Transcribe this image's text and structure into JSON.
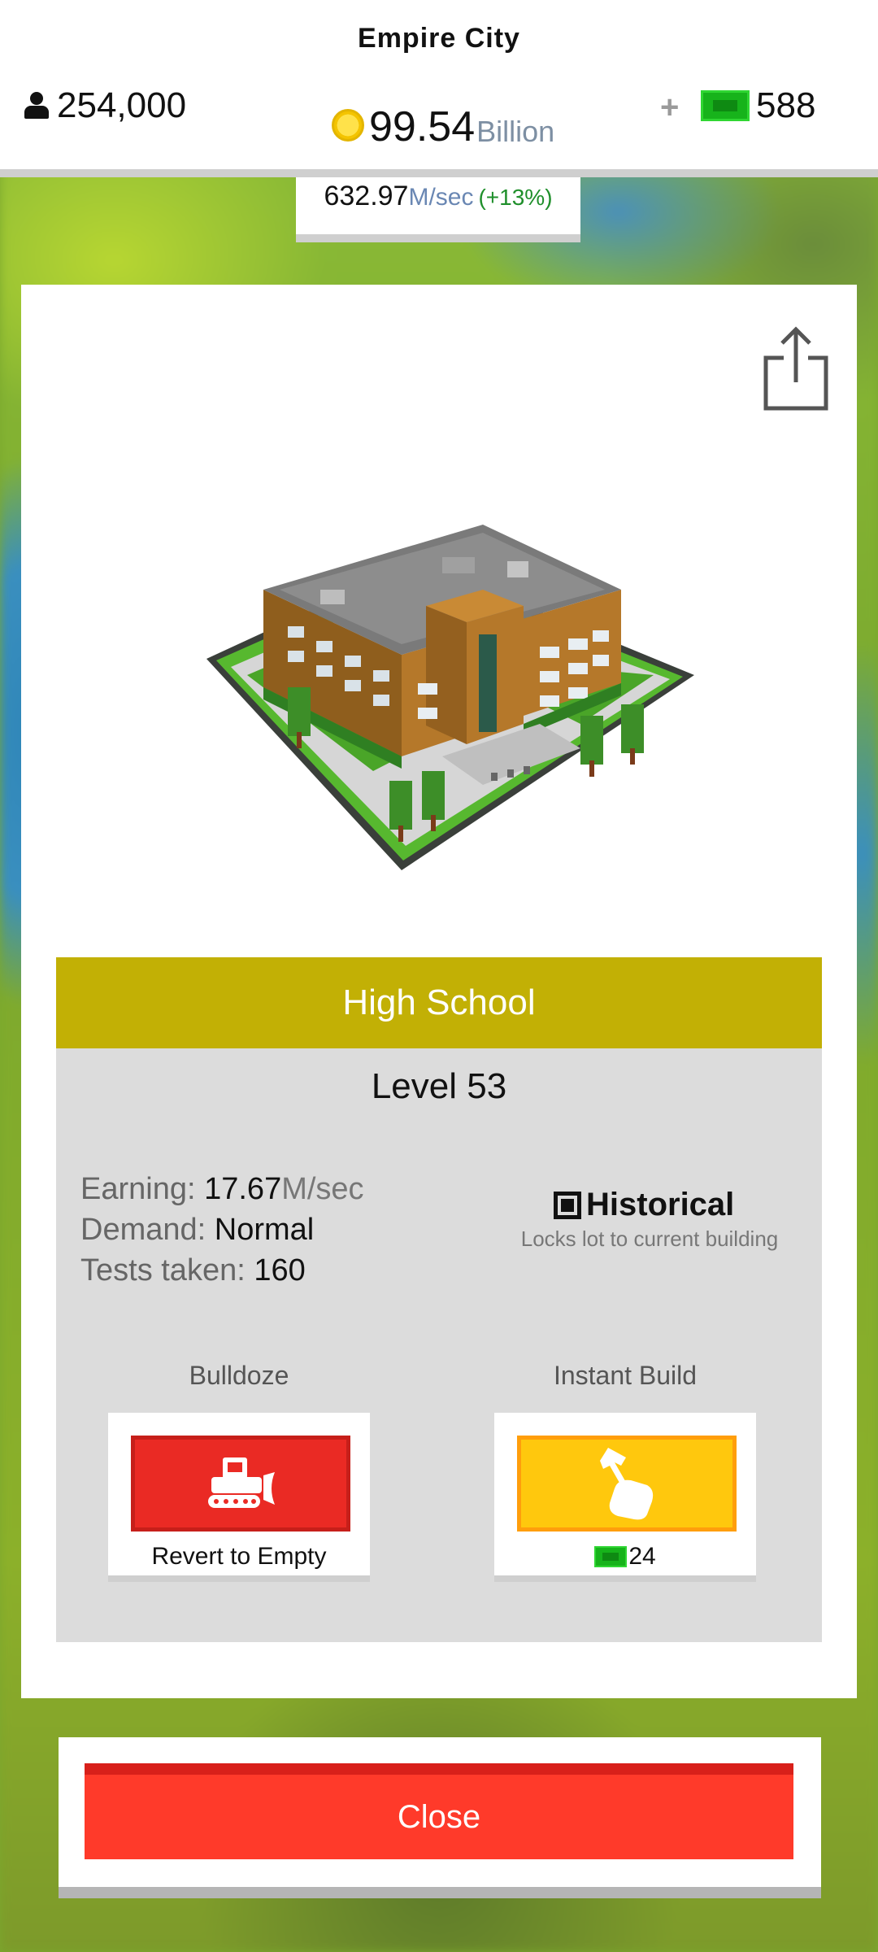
{
  "hud": {
    "city_name": "Empire City",
    "population": "254,000",
    "cash_value": "99.54",
    "cash_unit": "Billion",
    "gems": "588",
    "plus_label": "+",
    "income_value": "632.97",
    "income_unit": "M/sec",
    "income_change": "(+13%)"
  },
  "building": {
    "name": "High School",
    "level": "Level 53",
    "stats": {
      "earning_label": "Earning:",
      "earning_value": "17.67",
      "earning_unit": "M/sec",
      "demand_label": "Demand:",
      "demand_value": "Normal",
      "tests_label": "Tests taken:",
      "tests_value": "160"
    },
    "historical": {
      "label": "Historical",
      "description": "Locks lot to current building",
      "checked": true
    }
  },
  "actions": {
    "bulldoze_label": "Bulldoze",
    "bulldoze_caption": "Revert to Empty",
    "instant_build_label": "Instant Build",
    "instant_build_cost": "24"
  },
  "footer": {
    "close_label": "Close"
  },
  "icons": {
    "population": "person-icon",
    "cash": "coin-icon",
    "gems": "gem-icon",
    "share": "share-icon",
    "bulldoze": "bulldozer-icon",
    "instant_build": "hammer-hand-icon"
  },
  "colors": {
    "banner": "#c2b005",
    "bulldoze": "#ea2a24",
    "instant_build": "#ffc80d",
    "close": "#ff3a2a",
    "gem": "#17b31b"
  }
}
